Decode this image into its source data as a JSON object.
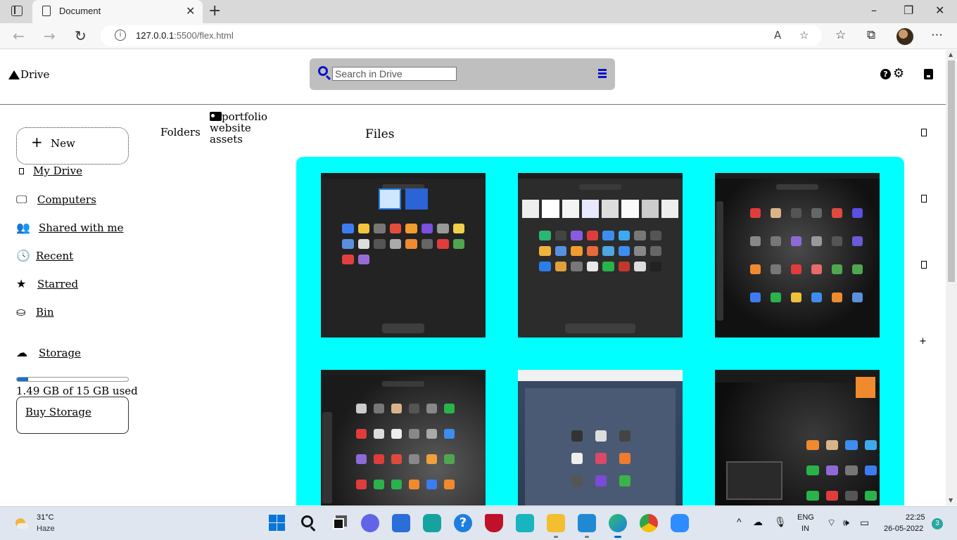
{
  "browser": {
    "tab_title": "Document",
    "url_host": "127.0.0.1",
    "url_rest": ":5500/flex.html"
  },
  "drive": {
    "logo_text": "Drive",
    "search_placeholder": "Search in Drive",
    "new_label": "New",
    "nav": [
      {
        "label": "My Drive",
        "icon": "drive-icon"
      },
      {
        "label": "Computers",
        "icon": "monitor-icon"
      },
      {
        "label": "Shared with me",
        "icon": "people-icon"
      },
      {
        "label": "Recent",
        "icon": "clock-icon"
      },
      {
        "label": "Starred",
        "icon": "star-icon"
      },
      {
        "label": "Bin",
        "icon": "bin-icon"
      },
      {
        "label": "Storage",
        "icon": "cloud-icon"
      }
    ],
    "storage_used_fraction": 0.1,
    "storage_text": "1.49 GB of 15 GB used",
    "buy_storage_label": "Buy Storage",
    "folders_label": "Folders",
    "folder_name": "portfolio website assets",
    "files_label": "Files",
    "panel_color": "#00ffff",
    "accent_color": "#0a14c8"
  },
  "taskbar": {
    "weather_temp": "31°C",
    "weather_cond": "Haze",
    "lang_line1": "ENG",
    "lang_line2": "IN",
    "time": "22:25",
    "date": "26-05-2022",
    "notification_count": "3"
  }
}
